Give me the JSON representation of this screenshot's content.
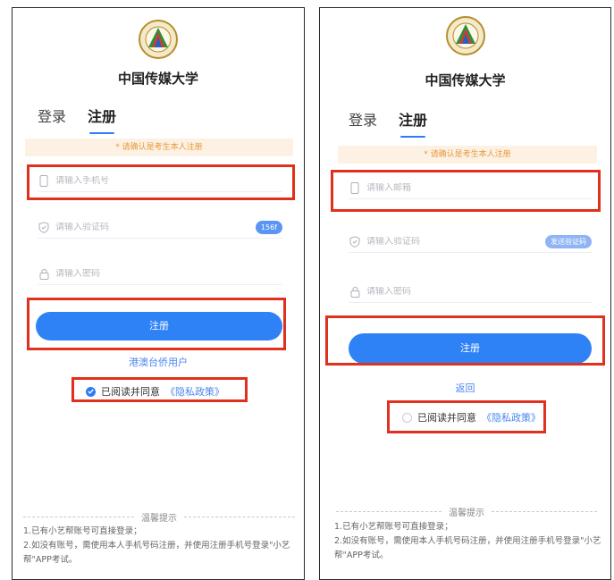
{
  "left": {
    "school_name": "中国传媒大学",
    "tabs": [
      "登录",
      "注册"
    ],
    "notice": "* 请确认是考生本人注册",
    "phone_placeholder": "请输入手机号",
    "code_placeholder": "请输入验证码",
    "code_button": "156f",
    "password_placeholder": "请输入密码",
    "submit": "注册",
    "alt_link": "港澳台侨用户",
    "agree_text": "已阅读并同意",
    "policy_link": "《隐私政策》",
    "agree_checked": true,
    "tips_title": "温馨提示",
    "tips": [
      "1.已有小艺帮账号可直接登录；",
      "2.如没有账号，需使用本人手机号码注册，并使用注册手机号登录\"小艺帮\"APP考试。"
    ]
  },
  "right": {
    "school_name": "中国传媒大学",
    "tabs": [
      "登录",
      "注册"
    ],
    "notice": "* 请确认是考生本人注册",
    "email_placeholder": "请输入邮箱",
    "code_placeholder": "请输入验证码",
    "code_button": "发送验证码",
    "password_placeholder": "请输入密码",
    "submit": "注册",
    "back_link": "返回",
    "agree_text": "已阅读并同意",
    "policy_link": "《隐私政策》",
    "agree_checked": false,
    "tips_title": "温馨提示",
    "tips": [
      "1.已有小艺帮账号可直接登录；",
      "2.如没有账号，需使用本人手机号码注册，并使用注册手机号登录\"小艺帮\"APP考试。"
    ]
  },
  "colors": {
    "accent": "#2f7bf5",
    "highlight": "#e0301e",
    "notice_bg": "#fdf1e3",
    "notice_text": "#e69a3c"
  }
}
